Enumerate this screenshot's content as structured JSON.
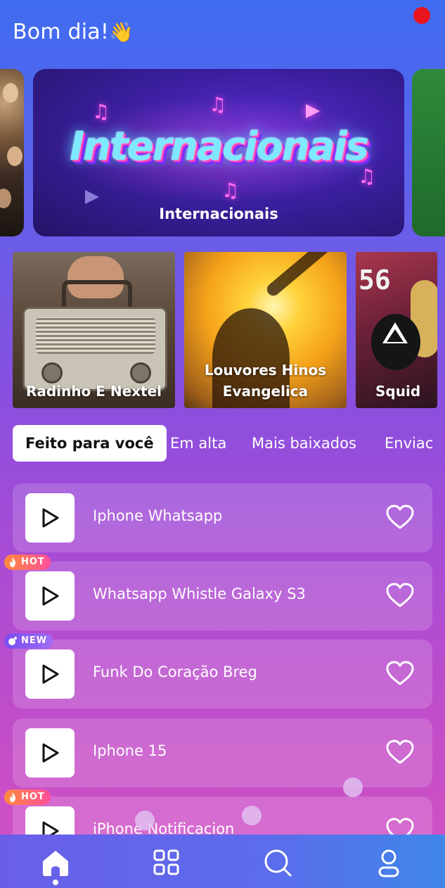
{
  "header": {
    "greeting": "Bom dia!",
    "wave_emoji": "👋"
  },
  "banner": {
    "title_art": "Internacionais",
    "label": "Internacionais"
  },
  "categories": [
    {
      "label": "Radinho E Nextel"
    },
    {
      "label_line1": "Louvores Hinos",
      "label_line2": "Evangelica"
    },
    {
      "label": "Squid",
      "badge_number": "56"
    }
  ],
  "tabs": [
    {
      "label": "Feito para você",
      "active": true
    },
    {
      "label": "Em alta"
    },
    {
      "label": "Mais baixados"
    },
    {
      "label": "Enviac"
    }
  ],
  "ringtones": [
    {
      "title": "Iphone Whatsapp",
      "badge": ""
    },
    {
      "title": "Whatsapp Whistle Galaxy S3",
      "badge": "HOT"
    },
    {
      "title": "Funk Do Coração Breg",
      "badge": "NEW"
    },
    {
      "title": "Iphone 15",
      "badge": ""
    },
    {
      "title": "iPhone Notificacion",
      "badge": "HOT"
    }
  ],
  "nav": [
    {
      "icon": "home-icon",
      "active": true
    },
    {
      "icon": "grid-icon"
    },
    {
      "icon": "search-icon"
    },
    {
      "icon": "profile-icon"
    }
  ],
  "colors": {
    "record_dot": "#e8141e",
    "hot_badge": "#ff6a6a",
    "new_badge": "#8a5cf2"
  }
}
